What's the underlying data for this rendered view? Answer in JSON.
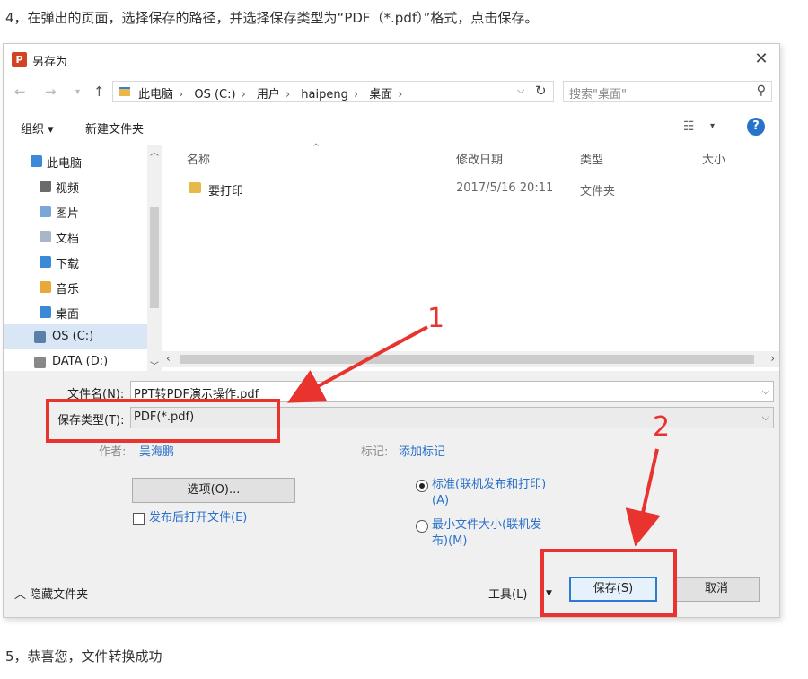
{
  "captions": {
    "top": "4，在弹出的页面，选择保存的路径，并选择保存类型为“PDF（*.pdf）”格式，点击保存。",
    "bottom": "5，恭喜您，文件转换成功"
  },
  "dialog": {
    "title": "另存为",
    "app_icon_letter": "P",
    "close_glyph": "✕"
  },
  "address": {
    "crumbs": [
      "此电脑",
      "OS (C:)",
      "用户",
      "haipeng",
      "桌面"
    ],
    "search_placeholder": "搜索\"桌面\""
  },
  "toolbar": {
    "organize": "组织 ▾",
    "new_folder": "新建文件夹",
    "help": "?"
  },
  "nav_pane": {
    "items": [
      {
        "label": "此电脑",
        "color": "#3a8ad8"
      },
      {
        "label": "视频",
        "color": "#6b6b6b"
      },
      {
        "label": "图片",
        "color": "#7aa7d8"
      },
      {
        "label": "文档",
        "color": "#a9b6c7"
      },
      {
        "label": "下载",
        "color": "#3a8ad8"
      },
      {
        "label": "音乐",
        "color": "#e8a83a"
      },
      {
        "label": "桌面",
        "color": "#3a8ad8"
      },
      {
        "label": "OS (C:)",
        "color": "#5a7fa8"
      },
      {
        "label": "DATA (D:)",
        "color": "#888888"
      }
    ]
  },
  "file_list": {
    "columns": [
      "名称",
      "修改日期",
      "类型",
      "大小"
    ],
    "rows": [
      {
        "name": "要打印",
        "modified": "2017/5/16 20:11",
        "type": "文件夹",
        "size": ""
      }
    ]
  },
  "form": {
    "filename_label": "文件名(N):",
    "filename_value": "PPT转PDF演示操作.pdf",
    "savetype_label": "保存类型(T):",
    "savetype_value": "PDF(*.pdf)",
    "author_label": "作者:",
    "author_value": "吴海鹏",
    "tags_label": "标记:",
    "tags_value": "添加标记",
    "options_button": "选项(O)...",
    "open_after_publish": "发布后打开文件(E)",
    "radio_standard": "标准(联机发布和打印)(A)",
    "radio_minimum": "最小文件大小(联机发布)(M)",
    "hide_folders": "隐藏文件夹",
    "tools": "工具(L)",
    "save": "保存(S)",
    "cancel": "取消"
  },
  "annotations": {
    "label_1": "1",
    "label_2": "2",
    "color": "#e8332f"
  }
}
